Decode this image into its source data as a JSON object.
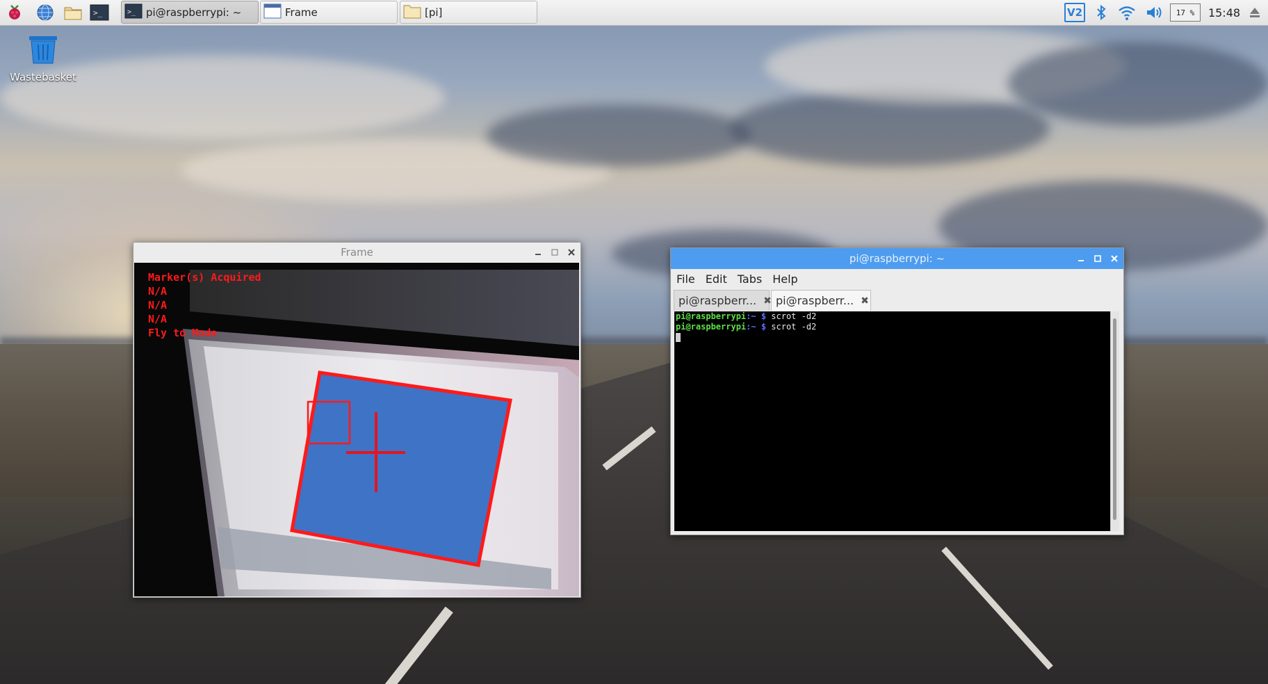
{
  "taskbar": {
    "launchers": [
      {
        "icon": "raspberry-menu-icon"
      },
      {
        "icon": "web-browser-icon"
      },
      {
        "icon": "file-manager-icon"
      },
      {
        "icon": "terminal-icon"
      }
    ],
    "tasks": [
      {
        "label": "pi@raspberrypi: ~",
        "icon": "terminal-icon",
        "active": true
      },
      {
        "label": "Frame",
        "icon": "window-icon",
        "active": false
      },
      {
        "label": "[pi]",
        "icon": "folder-icon",
        "active": false
      }
    ],
    "tray": {
      "vnc": "V2",
      "battery": "17 %",
      "clock": "15:48"
    }
  },
  "desktop": {
    "icons": [
      {
        "label": "Wastebasket",
        "icon": "trash-icon"
      }
    ]
  },
  "frame_window": {
    "title": "Frame",
    "overlay_lines": [
      "Marker(s) Acquired",
      "N/A",
      "N/A",
      "N/A",
      "Fly to Mode"
    ],
    "overlay_color": "#ff1a1a"
  },
  "terminal_window": {
    "title": "pi@raspberrypi: ~",
    "menu": [
      "File",
      "Edit",
      "Tabs",
      "Help"
    ],
    "tabs": [
      {
        "label": "pi@raspberr...",
        "active": false
      },
      {
        "label": "pi@raspberr...",
        "active": true
      }
    ],
    "lines": [
      {
        "user": "pi@raspberrypi",
        "path": ":~",
        "sym": " $",
        "cmd": " scrot -d2"
      },
      {
        "user": "pi@raspberrypi",
        "path": ":~",
        "sym": " $",
        "cmd": " scrot -d2"
      }
    ],
    "titlebar_color": "#4d9cef"
  }
}
